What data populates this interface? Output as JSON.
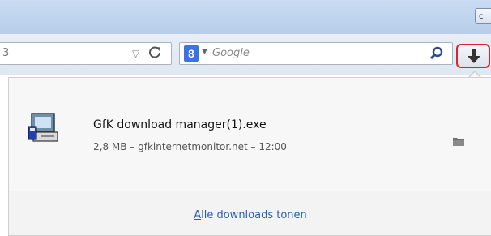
{
  "window": {
    "button_label": "c"
  },
  "url": {
    "fragment": "3"
  },
  "search": {
    "engine_logo": "8",
    "placeholder": "Google"
  },
  "download": {
    "filename": "GfK download manager(1).exe",
    "meta": "2,8 MB – gfkinternetmonitor.net – 12:00"
  },
  "footer": {
    "link_accesskey": "A",
    "link_rest": "lle downloads tonen"
  },
  "colors": {
    "highlight": "#e0202a",
    "link": "#2a5db0"
  },
  "icons": {
    "dropdown": "dropmarker-icon",
    "reload": "reload-icon",
    "search": "search-icon",
    "downloads": "download-arrow-icon",
    "file": "installer-icon",
    "folder": "folder-icon"
  }
}
